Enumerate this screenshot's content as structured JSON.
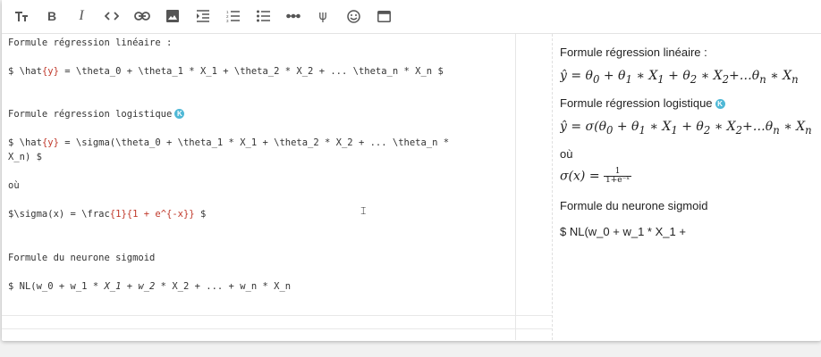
{
  "toolbar": {
    "buttons": [
      {
        "name": "text-size-icon"
      },
      {
        "name": "bold-icon",
        "glyph": "B"
      },
      {
        "name": "italic-icon",
        "glyph": "I"
      },
      {
        "name": "code-icon"
      },
      {
        "name": "link-icon"
      },
      {
        "name": "image-icon"
      },
      {
        "name": "indent-icon"
      },
      {
        "name": "ordered-list-icon"
      },
      {
        "name": "bullet-list-icon"
      },
      {
        "name": "horizontal-rule-icon"
      },
      {
        "name": "psi-icon",
        "glyph": "ψ"
      },
      {
        "name": "emoji-icon"
      },
      {
        "name": "window-icon"
      }
    ]
  },
  "source": {
    "l1": "Formule régression linéaire :",
    "l2a": "$ \\hat",
    "l2b": "{y}",
    "l2c": " = \\theta_0 + \\theta_1 * X_1 + \\theta_2 * X_2 + ... \\theta_n * X_n $",
    "l3": "Formule régression logistique",
    "l3badge": "K",
    "l4a": "$ \\hat",
    "l4b": "{y}",
    "l4c": " = \\sigma(\\theta_0 + \\theta_1 * X_1 + \\theta_2 * X_2 + ... \\theta_n *",
    "l5": "X_n) $",
    "l6": "où",
    "l7a": "$\\sigma(x) = \\frac",
    "l7b": "{1}{1 + e^{-x}}",
    "l7c": " $",
    "l8": "Formule du neurone sigmoid",
    "l9a": "$ NL(w_0 + w_1 ",
    "l9b": "* X_1 + w_2 *",
    "l9c": " X_2 + ... + w_n * X_n"
  },
  "preview": {
    "p1": "Formule régression linéaire :",
    "p3": "Formule régression logistique",
    "p3badge": "K",
    "p5": "où",
    "frac_num": "1",
    "frac_den": "1+e⁻ˣ",
    "p7": "Formule du neurone sigmoid",
    "p8": "$ NL(w_0 + w_1 * X_1 +"
  },
  "colors": {
    "accent": "#4fb8d6",
    "latex_arg": "#c0392b"
  }
}
